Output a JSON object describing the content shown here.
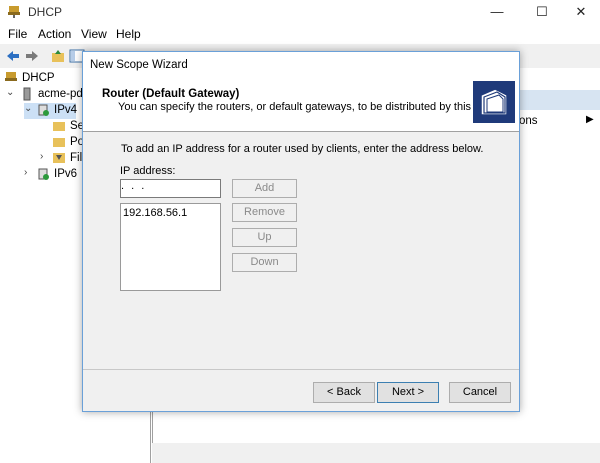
{
  "window": {
    "title": "DHCP",
    "controls": {
      "minimize": "—",
      "maximize": "☐",
      "close": "✕"
    }
  },
  "menu": [
    {
      "label": "File"
    },
    {
      "label": "Action"
    },
    {
      "label": "View"
    },
    {
      "label": "Help"
    }
  ],
  "toolbar_icons": [
    "back-arrow-icon",
    "forward-arrow-icon",
    "up-folder-icon",
    "show-hide-tree-icon"
  ],
  "tree": {
    "root": "DHCP",
    "server": "acme-pde",
    "ipv4": "IPv4",
    "children": [
      "Se",
      "Po",
      "Fil"
    ],
    "ipv6": "IPv6"
  },
  "actions_pane": {
    "item_fragment": "ons"
  },
  "wizard": {
    "title": "New Scope Wizard",
    "heading": "Router (Default Gateway)",
    "subheading": "You can specify the routers, or default gateways, to be distributed by this scope.",
    "instruction": "To add an IP address for a router used by clients, enter the address below.",
    "ip_label": "IP address:",
    "ip_value": " .  .  . ",
    "router_list": [
      "192.168.56.1"
    ],
    "buttons": {
      "add": "Add",
      "remove": "Remove",
      "up": "Up",
      "down": "Down",
      "back": "< Back",
      "next": "Next >",
      "cancel": "Cancel"
    }
  },
  "colors": {
    "logo_background": "#1f3a7a",
    "actions_header": "#d7e4f2",
    "dialog_border": "#6aa0d8"
  }
}
